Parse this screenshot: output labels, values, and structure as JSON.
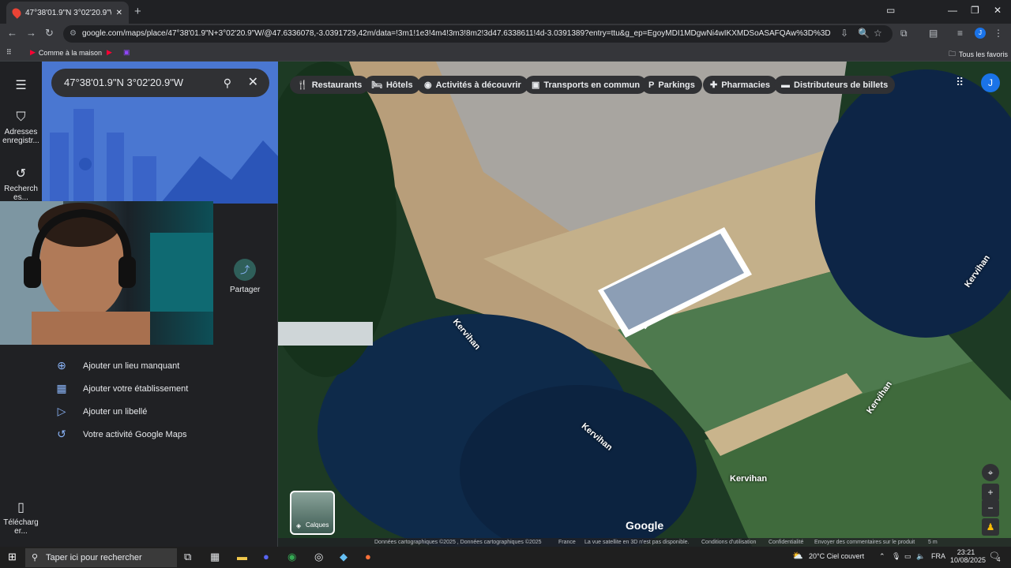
{
  "browser": {
    "tab_title": "47°38'01.9\"N 3°02'20.9\"W - Go",
    "url": "google.com/maps/place/47°38'01.9\"N+3°02'20.9\"W/@47.6336078,-3.0391729,42m/data=!3m1!1e3!4m4!3m3!8m2!3d47.6338611!4d-3.0391389?entry=ttu&g_ep=EgoyMDI1MDgwNi4wIKXMDSoASAFQAw%3D%3D",
    "bookmarks": [
      "Comme à la maison"
    ],
    "all_bookmarks": "Tous les favoris",
    "profile_initial": "J"
  },
  "rail": {
    "saved": "Adresses enregistr...",
    "recent": "Recherch es...",
    "download": "Télécharg er..."
  },
  "panel": {
    "search_value": "47°38'01.9\"N 3°02'20.9\"W",
    "share_label": "Partager",
    "partial_text": "e",
    "menu": [
      {
        "label": "Ajouter un lieu manquant",
        "icon": "add-location-icon"
      },
      {
        "label": "Ajouter votre établissement",
        "icon": "add-business-icon"
      },
      {
        "label": "Ajouter un libellé",
        "icon": "label-icon"
      },
      {
        "label": "Votre activité Google Maps",
        "icon": "history-icon"
      }
    ]
  },
  "chips": [
    "Restaurants",
    "Hôtels",
    "Activités à découvrir",
    "Transports en commun",
    "Parkings",
    "Pharmacies",
    "Distributeurs de billets"
  ],
  "map": {
    "street_labels": [
      "Kervihan",
      "Kervihan",
      "Kervihan",
      "Kervihan",
      "Kervihan"
    ],
    "layers_label": "Calques",
    "logo": "Google",
    "user_initial": "J"
  },
  "attribution": {
    "data": "Données cartographiques ©2025 , Données cartographiques ©2025",
    "country": "France",
    "notice": "La vue satellite en 3D n'est pas disponible.",
    "terms": "Conditions d'utilisation",
    "privacy": "Confidentialité",
    "feedback": "Envoyer des commentaires sur le produit",
    "scale": "5 m"
  },
  "taskbar": {
    "search_placeholder": "Taper ici pour rechercher",
    "weather": "20°C  Ciel couvert",
    "lang": "FRA",
    "time": "23:21",
    "date": "10/08/2025",
    "notif_count": "4"
  }
}
